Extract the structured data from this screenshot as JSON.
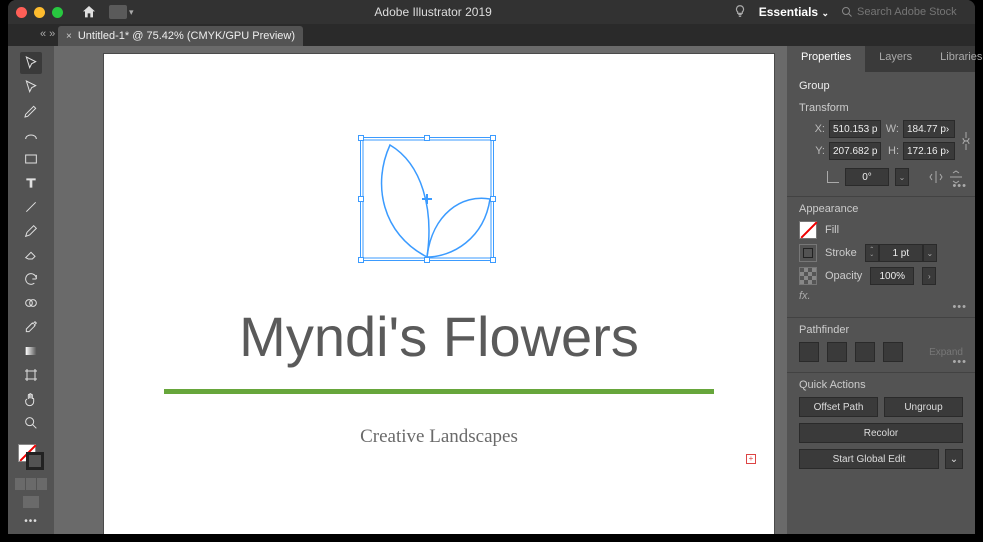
{
  "app": {
    "title": "Adobe Illustrator 2019"
  },
  "workspace": {
    "label": "Essentials"
  },
  "search": {
    "placeholder": "Search Adobe Stock"
  },
  "tab": {
    "label": "Untitled-1* @ 75.42% (CMYK/GPU Preview)"
  },
  "canvas": {
    "headline": "Myndi's Flowers",
    "subhead": "Creative Landscapes"
  },
  "panel_tabs": {
    "properties": "Properties",
    "layers": "Layers",
    "libraries": "Libraries"
  },
  "selection_type": "Group",
  "transform": {
    "title": "Transform",
    "x_label": "X:",
    "x": "510.153 p",
    "y_label": "Y:",
    "y": "207.682 p",
    "w_label": "W:",
    "w": "184.77 p›",
    "h_label": "H:",
    "h": "172.16 p›",
    "rotate": "0°"
  },
  "appearance": {
    "title": "Appearance",
    "fill_label": "Fill",
    "stroke_label": "Stroke",
    "stroke_weight": "1 pt",
    "opacity_label": "Opacity",
    "opacity": "100%"
  },
  "pathfinder": {
    "title": "Pathfinder",
    "expand": "Expand"
  },
  "quick_actions": {
    "title": "Quick Actions",
    "offset_path": "Offset Path",
    "ungroup": "Ungroup",
    "recolor": "Recolor",
    "start_global_edit": "Start Global Edit"
  }
}
